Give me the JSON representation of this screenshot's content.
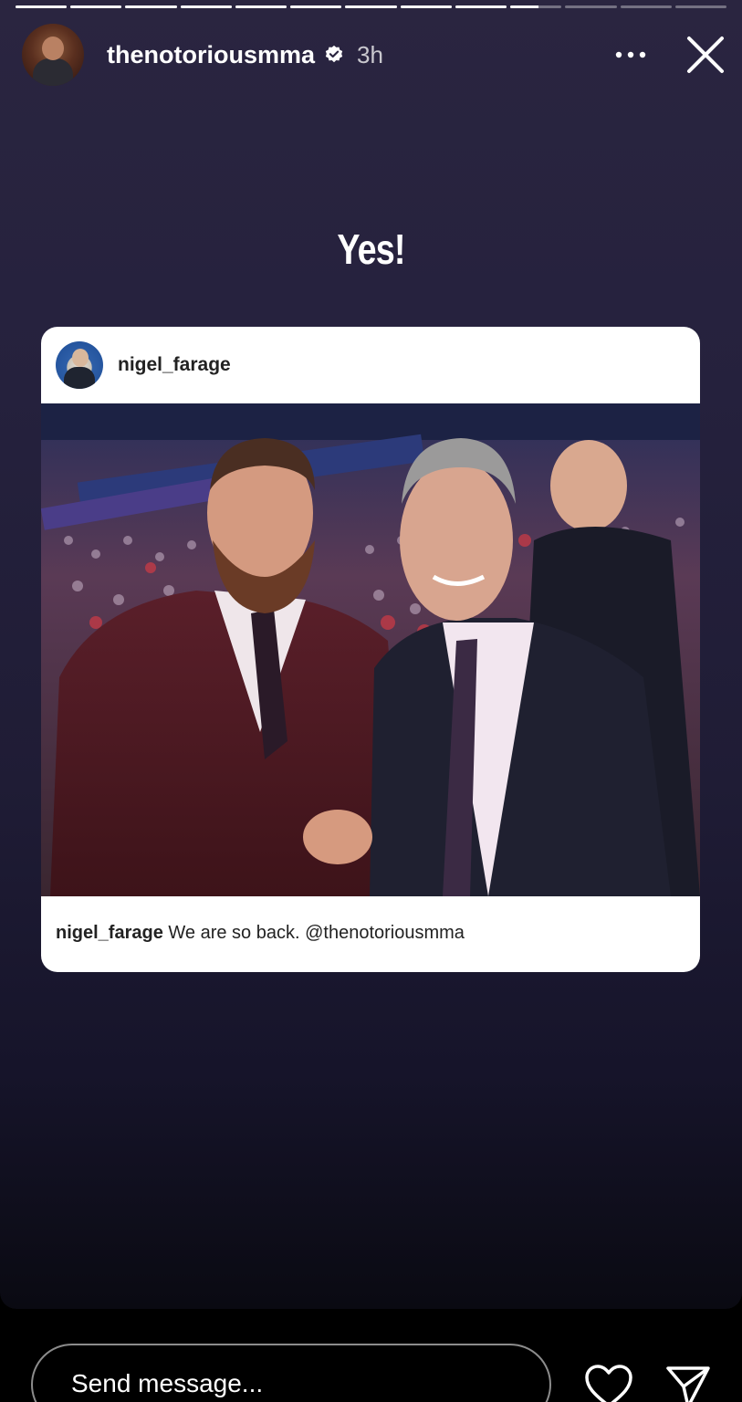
{
  "story": {
    "username": "thenotoriousmma",
    "time": "3h",
    "text": "Yes!",
    "progress_segments_total": 13,
    "progress_segments_viewed": 9,
    "progress_current_fraction": 0.55
  },
  "embedded_post": {
    "username": "nigel_farage",
    "caption_user": "nigel_farage",
    "caption_text": "We are so back. @thenotoriousmma"
  },
  "reply": {
    "placeholder": "Send message..."
  },
  "icons": {
    "verified": "verified-badge-icon",
    "more": "more-dots-icon",
    "close": "close-icon",
    "like": "heart-icon",
    "share": "paper-plane-icon"
  },
  "colors": {
    "background_top": "#2a2540",
    "background_bottom": "#0a0a12",
    "card": "#ffffff"
  }
}
